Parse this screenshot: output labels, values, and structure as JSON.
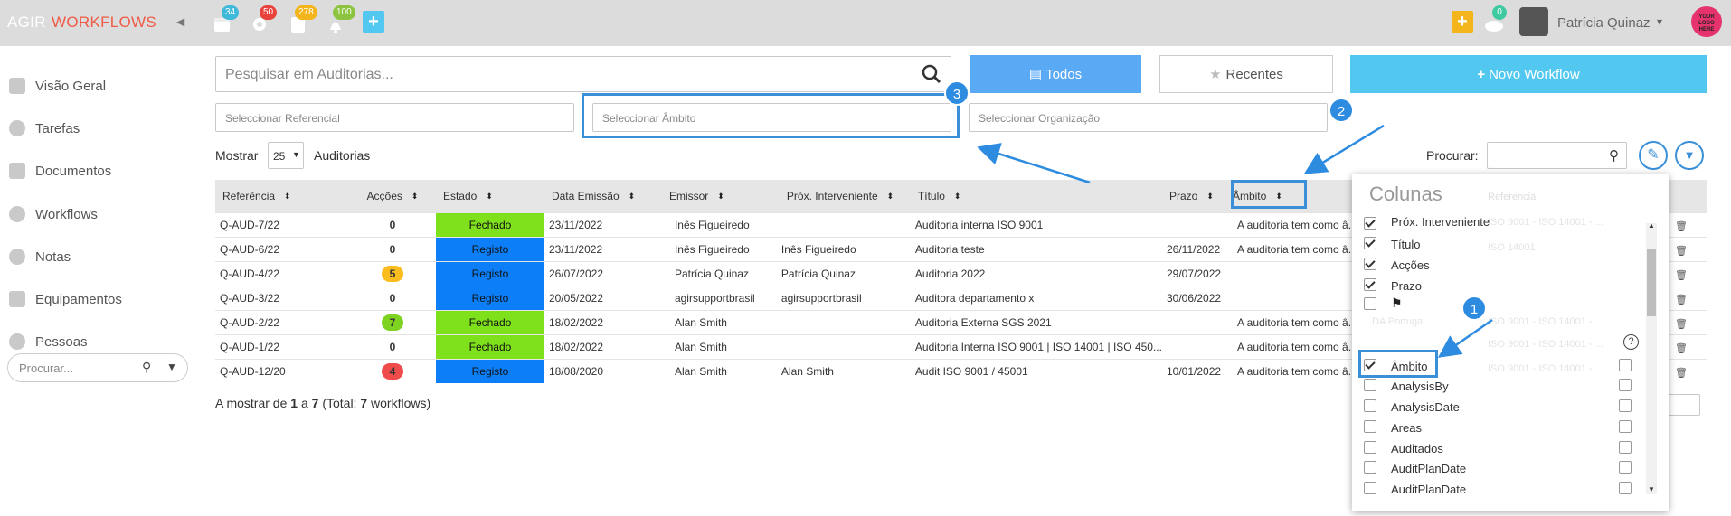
{
  "topbar": {
    "brand_agir": "AGIR",
    "brand_workflows": "WORKFLOWS",
    "badges": [
      "34",
      "50",
      "278",
      "100"
    ],
    "notification_badge": "0",
    "user_name": "Patrícia Quinaz",
    "logo_text": "YOUR LOGO HERE"
  },
  "sidebar": {
    "items": [
      {
        "label": "Visão Geral",
        "icon": "home-icon"
      },
      {
        "label": "Tarefas",
        "icon": "gear-icon"
      },
      {
        "label": "Documentos",
        "icon": "document-icon"
      },
      {
        "label": "Workflows",
        "icon": "workflow-icon"
      },
      {
        "label": "Notas",
        "icon": "chat-icon"
      },
      {
        "label": "Equipamentos",
        "icon": "wrench-icon"
      },
      {
        "label": "Pessoas",
        "icon": "person-icon"
      }
    ],
    "search_placeholder": "Procurar..."
  },
  "search": {
    "placeholder": "Pesquisar em Auditorias..."
  },
  "buttons": {
    "todos": "Todos",
    "recentes": "Recentes",
    "novo_workflow": "Novo Workflow"
  },
  "filters": {
    "referencial": "Seleccionar Referencial",
    "ambito": "Seleccionar Âmbito",
    "organizacao": "Seleccionar Organização"
  },
  "list_controls": {
    "mostrar": "Mostrar",
    "page_size": "25",
    "auditorias": "Auditorias",
    "procurar": "Procurar:"
  },
  "table": {
    "headers": [
      "Referência",
      "Acções",
      "Estado",
      "Data Emissão",
      "Emissor",
      "Próx. Interveniente",
      "Título",
      "Prazo",
      "Âmbito"
    ],
    "rows": [
      {
        "ref": "Q-AUD-7/22",
        "acc": "0",
        "estado": "Fechado",
        "data": "23/11/2022",
        "emissor": "Inês Figueiredo",
        "prox": "",
        "titulo": "Auditoria interna ISO 9001",
        "prazo": "",
        "ambito": "A auditoria tem como â..."
      },
      {
        "ref": "Q-AUD-6/22",
        "acc": "0",
        "estado": "Registo",
        "data": "23/11/2022",
        "emissor": "Inês Figueiredo",
        "prox": "Inês Figueiredo",
        "titulo": "Auditoria teste",
        "prazo": "26/11/2022",
        "ambito": "A auditoria tem como â..."
      },
      {
        "ref": "Q-AUD-4/22",
        "acc": "5",
        "estado": "Registo",
        "data": "26/07/2022",
        "emissor": "Patrícia Quinaz",
        "prox": "Patrícia Quinaz",
        "titulo": "Auditoria 2022",
        "prazo": "29/07/2022",
        "ambito": ""
      },
      {
        "ref": "Q-AUD-3/22",
        "acc": "0",
        "estado": "Registo",
        "data": "20/05/2022",
        "emissor": "agirsupportbrasil",
        "prox": "agirsupportbrasil",
        "titulo": "Auditora departamento x",
        "prazo": "30/06/2022",
        "ambito": ""
      },
      {
        "ref": "Q-AUD-2/22",
        "acc": "7",
        "estado": "Fechado",
        "data": "18/02/2022",
        "emissor": "Alan Smith",
        "prox": "",
        "titulo": "Auditoria Externa SGS 2021",
        "prazo": "",
        "ambito": "A auditoria tem como â..."
      },
      {
        "ref": "Q-AUD-1/22",
        "acc": "0",
        "estado": "Fechado",
        "data": "18/02/2022",
        "emissor": "Alan Smith",
        "prox": "",
        "titulo": "Auditoria Interna ISO 9001 | ISO 14001 | ISO 450...",
        "prazo": "",
        "ambito": "A auditoria tem como â..."
      },
      {
        "ref": "Q-AUD-12/20",
        "acc": "4",
        "estado": "Registo",
        "data": "18/08/2020",
        "emissor": "Alan Smith",
        "prox": "Alan Smith",
        "titulo": "Audit ISO 9001 / 45001",
        "prazo": "10/01/2022",
        "ambito": "A auditoria tem como â..."
      }
    ],
    "footer_prefix": "A mostrar de ",
    "footer_from": "1",
    "footer_a": " a ",
    "footer_to": "7",
    "footer_total_prefix": " (Total: ",
    "footer_total": "7",
    "footer_suffix": " workflows)"
  },
  "columns_panel": {
    "title": "Colunas",
    "items": [
      {
        "label": "Próx. Interveniente",
        "checked": true
      },
      {
        "label": "Título",
        "checked": true
      },
      {
        "label": "Acções",
        "checked": true
      },
      {
        "label": "Prazo",
        "checked": true
      },
      {
        "label": "",
        "checked": false,
        "flag": true
      },
      {
        "label": "Âmbito",
        "checked": true
      },
      {
        "label": "AnalysisBy",
        "checked": false
      },
      {
        "label": "AnalysisDate",
        "checked": false
      },
      {
        "label": "Areas",
        "checked": false
      },
      {
        "label": "Auditados",
        "checked": false
      },
      {
        "label": "AuditPlanDate",
        "checked": false
      },
      {
        "label": "AuditPlanDate",
        "checked": false
      }
    ],
    "bg_col_text": "Referencial",
    "bg_values": [
      "ISO 9001 - ISO 14001 - ...",
      "ISO 14001",
      "ISO 9001 - ISO 14001 - ...",
      "ISO 9001 - ISO 14001 - ...",
      "ISO 9001 - ISO 14001 - ..."
    ],
    "bg_org": "DA Portugal"
  },
  "markers": [
    "1",
    "2",
    "3"
  ],
  "colors": {
    "fechado": "#7fe01c",
    "registo": "#0b7ef8",
    "accent": "#3a8fd8",
    "novo": "#52c8f0",
    "todos": "#5aa9f5"
  }
}
